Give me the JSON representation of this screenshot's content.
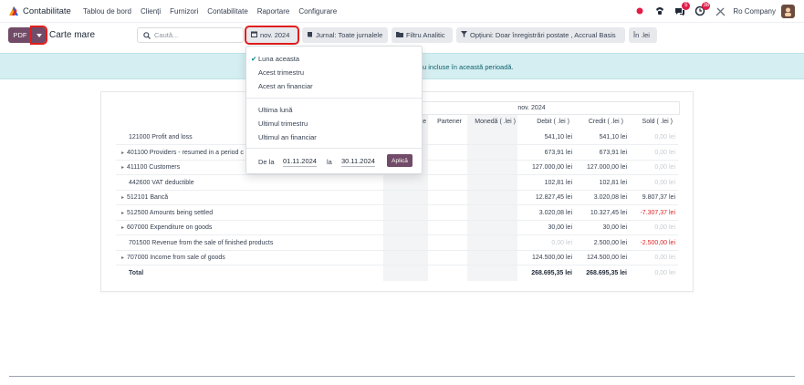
{
  "nav": {
    "app": "Contabilitate",
    "menu": [
      "Tablou de bord",
      "Clienți",
      "Furnizori",
      "Contabilitate",
      "Raportare",
      "Configurare"
    ],
    "chat_badge": "5",
    "activity_badge": "38",
    "company": "Ro Company"
  },
  "toolbar": {
    "pdf_label": "PDF",
    "breadcrumb": "Carte mare",
    "search_placeholder": "Caută...",
    "date_filter": "nov. 2024",
    "journal_filter": "Jurnal: Toate jurnalele",
    "analytic_filter": "Filtru Analitic",
    "options_filter": "Opțiuni: Doar înregistrări postate , Accrual Basis",
    "currency_filter": "În .lei"
  },
  "info_text": "u incluse în această perioadă.",
  "dropdown": {
    "items_group1": [
      "Luna aceasta",
      "Acest trimestru",
      "Acest an financiar"
    ],
    "items_group2": [
      "Ultima lună",
      "Ultimul trimestru",
      "Ultimul an financiar"
    ],
    "from_label": "De la",
    "from_date": "01.11.2024",
    "to_label": "la",
    "to_date": "30.11.2024",
    "apply_label": "Aplică"
  },
  "report": {
    "period": "nov. 2024",
    "columns": [
      "e",
      "Partener",
      "Monedă ( .lei )",
      "Debit ( .lei )",
      "Credit ( .lei )",
      "Sold ( .lei )"
    ],
    "rows": [
      {
        "account": "121000 Profit and loss",
        "expandable": false,
        "debit": "541,10 lei",
        "credit": "541,10 lei",
        "sold": "0,00 lei",
        "sold_style": "zero",
        "debit_style": ""
      },
      {
        "account": "401100 Providers - resumed in a period c",
        "expandable": true,
        "debit": "673,91 lei",
        "credit": "673,91 lei",
        "sold": "0,00 lei",
        "sold_style": "zero",
        "debit_style": ""
      },
      {
        "account": "411100 Customers",
        "expandable": true,
        "debit": "127.000,00 lei",
        "credit": "127.000,00 lei",
        "sold": "0,00 lei",
        "sold_style": "zero",
        "debit_style": ""
      },
      {
        "account": "442600 VAT deductible",
        "expandable": false,
        "debit": "102,81 lei",
        "credit": "102,81 lei",
        "sold": "0,00 lei",
        "sold_style": "zero",
        "debit_style": ""
      },
      {
        "account": "512101 Bancă",
        "expandable": true,
        "debit": "12.827,45 lei",
        "credit": "3.020,08 lei",
        "sold": "9.807,37 lei",
        "sold_style": "",
        "debit_style": ""
      },
      {
        "account": "512500 Amounts being settled",
        "expandable": true,
        "debit": "3.020,08 lei",
        "credit": "10.327,45 lei",
        "sold": "-7.307,37 lei",
        "sold_style": "neg",
        "debit_style": ""
      },
      {
        "account": "607000 Expenditure on goods",
        "expandable": true,
        "debit": "30,00 lei",
        "credit": "30,00 lei",
        "sold": "0,00 lei",
        "sold_style": "zero",
        "debit_style": ""
      },
      {
        "account": "701500 Revenue from the sale of finished products",
        "expandable": false,
        "debit": "0,00 lei",
        "credit": "2.500,00 lei",
        "sold": "-2.500,00 lei",
        "sold_style": "neg",
        "debit_style": "zero"
      },
      {
        "account": "707000 Income from sale of goods",
        "expandable": true,
        "debit": "124.500,00 lei",
        "credit": "124.500,00 lei",
        "sold": "0,00 lei",
        "sold_style": "zero",
        "debit_style": ""
      }
    ],
    "total": {
      "label": "Total",
      "debit": "268.695,35 lei",
      "credit": "268.695,35 lei",
      "sold": "0,00 lei"
    }
  },
  "colors": {
    "brand": "#714b67",
    "highlight": "#e11d1d",
    "info_bg": "#d4eef1",
    "negative": "#dc2626"
  }
}
